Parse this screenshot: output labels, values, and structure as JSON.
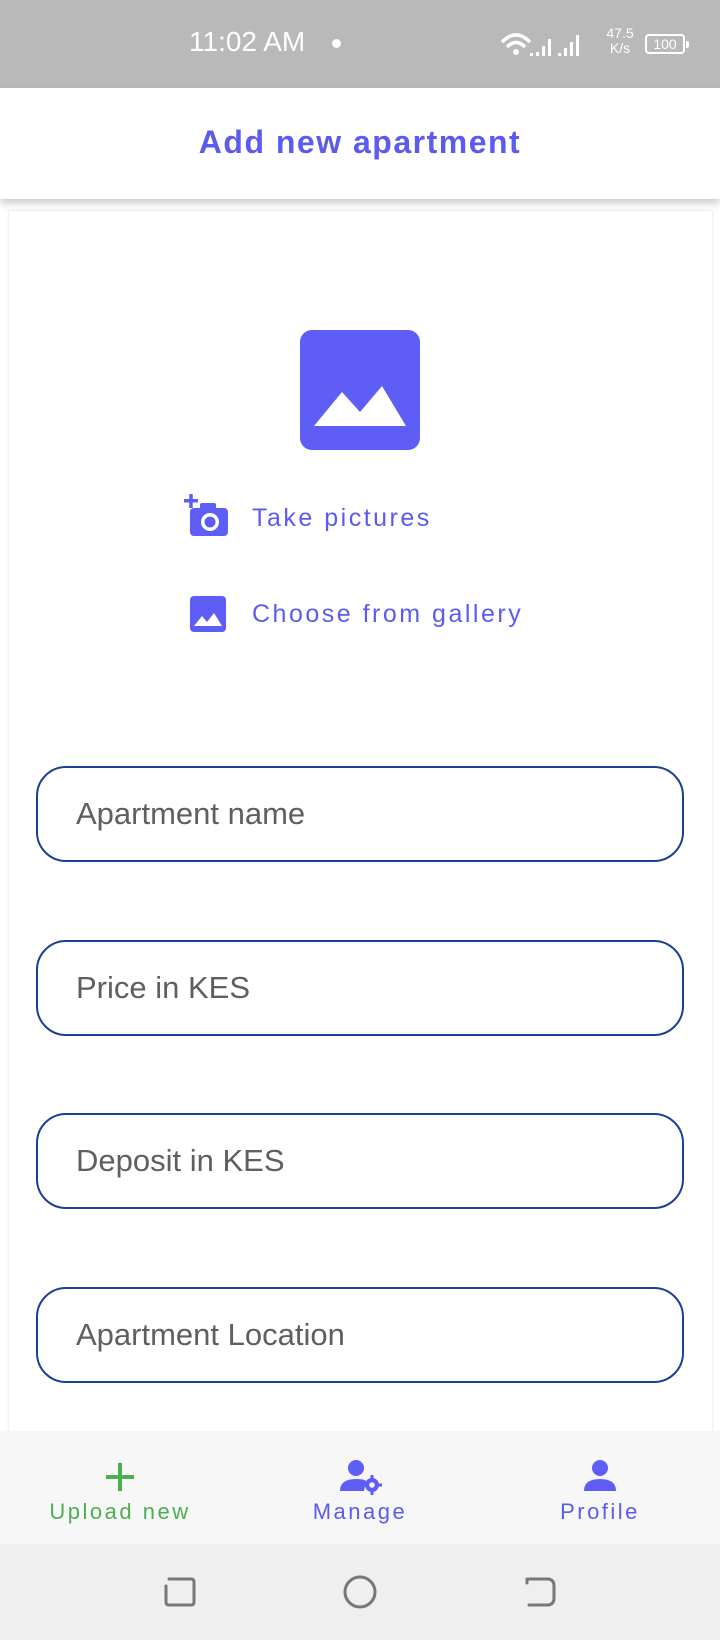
{
  "status_bar": {
    "time": "11:02 AM",
    "net_speed_value": "47.5",
    "net_speed_unit": "K/s",
    "battery": "100"
  },
  "app_bar": {
    "title": "Add new apartment"
  },
  "media": {
    "image_placeholder_icon": "landscape-image-icon",
    "take_pictures_label": "Take pictures",
    "take_pictures_icon": "add-camera-icon",
    "choose_gallery_label": "Choose from gallery",
    "choose_gallery_icon": "gallery-image-icon"
  },
  "form": {
    "apartment_name": {
      "placeholder": "Apartment name",
      "value": ""
    },
    "price": {
      "placeholder": "Price in KES",
      "value": ""
    },
    "deposit": {
      "placeholder": "Deposit in KES",
      "value": ""
    },
    "location": {
      "placeholder": "Apartment Location",
      "value": ""
    }
  },
  "bottom_nav": {
    "items": [
      {
        "label": "Upload new",
        "icon": "plus-icon",
        "active": true
      },
      {
        "label": "Manage",
        "icon": "user-settings-icon",
        "active": false
      },
      {
        "label": "Profile",
        "icon": "person-icon",
        "active": false
      }
    ]
  },
  "colors": {
    "accent": "#5b5bf0",
    "active_nav": "#4caf50",
    "field_border": "#1c3f94",
    "status_bar": "#b9b9b9"
  }
}
